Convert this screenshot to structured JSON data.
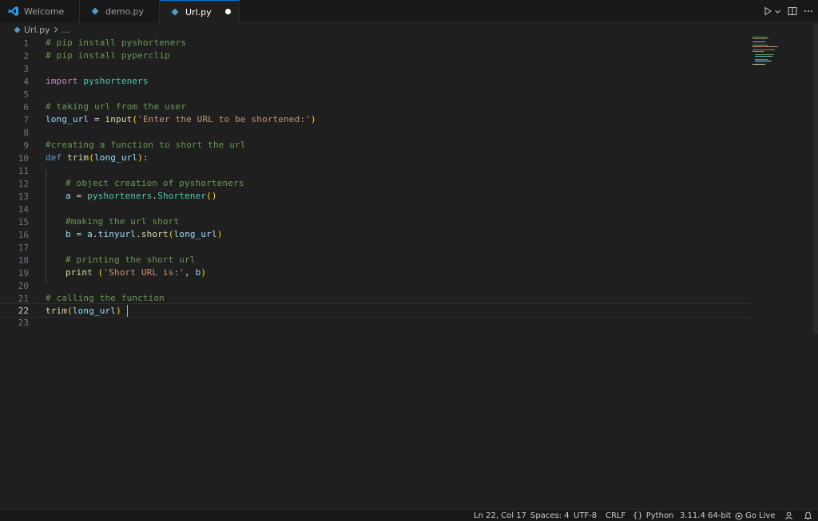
{
  "tabs": [
    {
      "label": "Welcome",
      "icon": "vscode-logo-icon",
      "active": false
    },
    {
      "label": "demo.py",
      "icon": "python-file-icon",
      "active": false
    },
    {
      "label": "Url.py",
      "icon": "python-file-icon",
      "active": true,
      "unsaved": true
    }
  ],
  "breadcrumb": {
    "file": "Url.py",
    "rest": "..."
  },
  "editor": {
    "line_numbers": [
      "1",
      "2",
      "3",
      "4",
      "5",
      "6",
      "7",
      "8",
      "9",
      "10",
      "11",
      "12",
      "13",
      "14",
      "15",
      "16",
      "17",
      "18",
      "19",
      "20",
      "21",
      "22",
      "23"
    ],
    "current_line": "22",
    "tokens": {
      "l1": "# pip install pyshorteners",
      "l2": "# pip install pyperclip",
      "l4_kw": "import",
      "l4_mod": "pyshorteners",
      "l6": "# taking url from the user",
      "l7_var": "long_url",
      "l7_eq": " = ",
      "l7_fn": "input",
      "l7_str": "'Enter the URL to be shortened:'",
      "l9": "#creating a function to short the url",
      "l10_def": "def",
      "l10_fn": "trim",
      "l10_param": "long_url",
      "l10_colon": ":",
      "l12": "# object creation of pyshorteners",
      "l13_var": "a",
      "l13_eq": " = ",
      "l13_mod": "pyshorteners",
      "l13_dot": ".",
      "l13_cls": "Shortener",
      "l15": "#making the url short",
      "l16_var": "b",
      "l16_eq": " = ",
      "l16_obj": "a",
      "l16_attr": "tinyurl",
      "l16_fn": "short",
      "l16_arg": "long_url",
      "l18": "# printing the short url",
      "l19_fn": "print",
      "l19_str": "'Short URL is:'",
      "l19_comma": ", ",
      "l19_var": "b",
      "l21": "# calling the function",
      "l22_fn": "trim",
      "l22_arg": "long_url"
    }
  },
  "statusbar": {
    "position": "Ln 22, Col 17",
    "spaces": "Spaces: 4",
    "encoding": "UTF-8",
    "eol": "CRLF",
    "language": "Python",
    "interpreter": "3.11.4 64-bit",
    "go_live": "Go Live"
  },
  "colors": {
    "accent": "#0078d4",
    "comment": "#6a9955",
    "keyword": "#c586c0",
    "string": "#ce9178",
    "function": "#dcdcaa",
    "variable": "#9cdcfe"
  }
}
